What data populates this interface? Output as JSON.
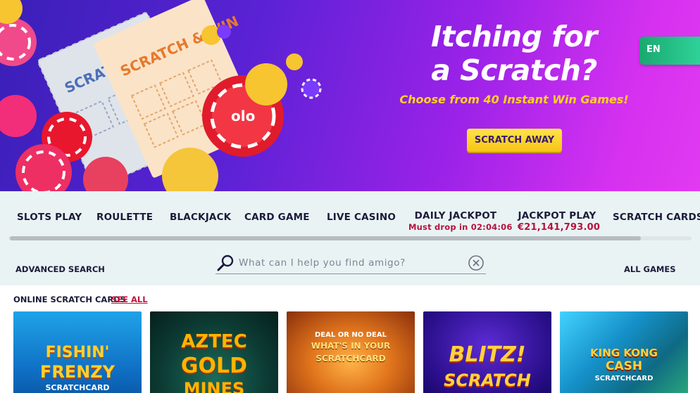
{
  "hero": {
    "title_line1": "Itching for",
    "title_line2": "a Scratch?",
    "subtitle": "Choose from 40 Instant Win Games!",
    "cta_label": "SCRATCH AWAY",
    "ticket_front_text": "SCRATCH & WIN",
    "ticket_back_text": "SCRATCH & WIN",
    "colors": {
      "gradient_start": "#3a1fb8",
      "gradient_end": "#e23af2",
      "subtitle": "#ffd21f",
      "cta": "#ffd82b"
    }
  },
  "language": {
    "label": "EN"
  },
  "nav": {
    "items": [
      {
        "label": "SLOTS PLAY",
        "sub": ""
      },
      {
        "label": "ROULETTE",
        "sub": ""
      },
      {
        "label": "BLACKJACK",
        "sub": ""
      },
      {
        "label": "CARD GAME",
        "sub": ""
      },
      {
        "label": "LIVE CASINO",
        "sub": ""
      },
      {
        "label": "DAILY JACKPOT",
        "sub": "Must drop in 02:04:06"
      },
      {
        "label": "JACKPOT PLAY",
        "sub": "€21,141,793.00"
      },
      {
        "label": "SCRATCH CARDS",
        "sub": ""
      }
    ]
  },
  "search": {
    "advanced_label": "ADVANCED SEARCH",
    "placeholder": "What can I help you find amigo?",
    "value": "",
    "all_games_label": "ALL GAMES"
  },
  "section": {
    "title": "ONLINE SCRATCH CARDS",
    "see_all": "SEE ALL"
  },
  "games": [
    {
      "line1": "FISHIN'",
      "line2": "FRENZY",
      "line3": "SCRATCHCARD"
    },
    {
      "line1": "AZTEC",
      "line2": "GOLD",
      "line3": "MINES"
    },
    {
      "line1": "DEAL OR NO DEAL",
      "line2": "WHAT'S IN YOUR",
      "line3": "SCRATCHCARD"
    },
    {
      "line1": "BLITZ!",
      "line2": "SCRATCH",
      "line3": ""
    },
    {
      "line1": "KING KONG",
      "line2": "CASH",
      "line3": "SCRATCHCARD"
    }
  ]
}
